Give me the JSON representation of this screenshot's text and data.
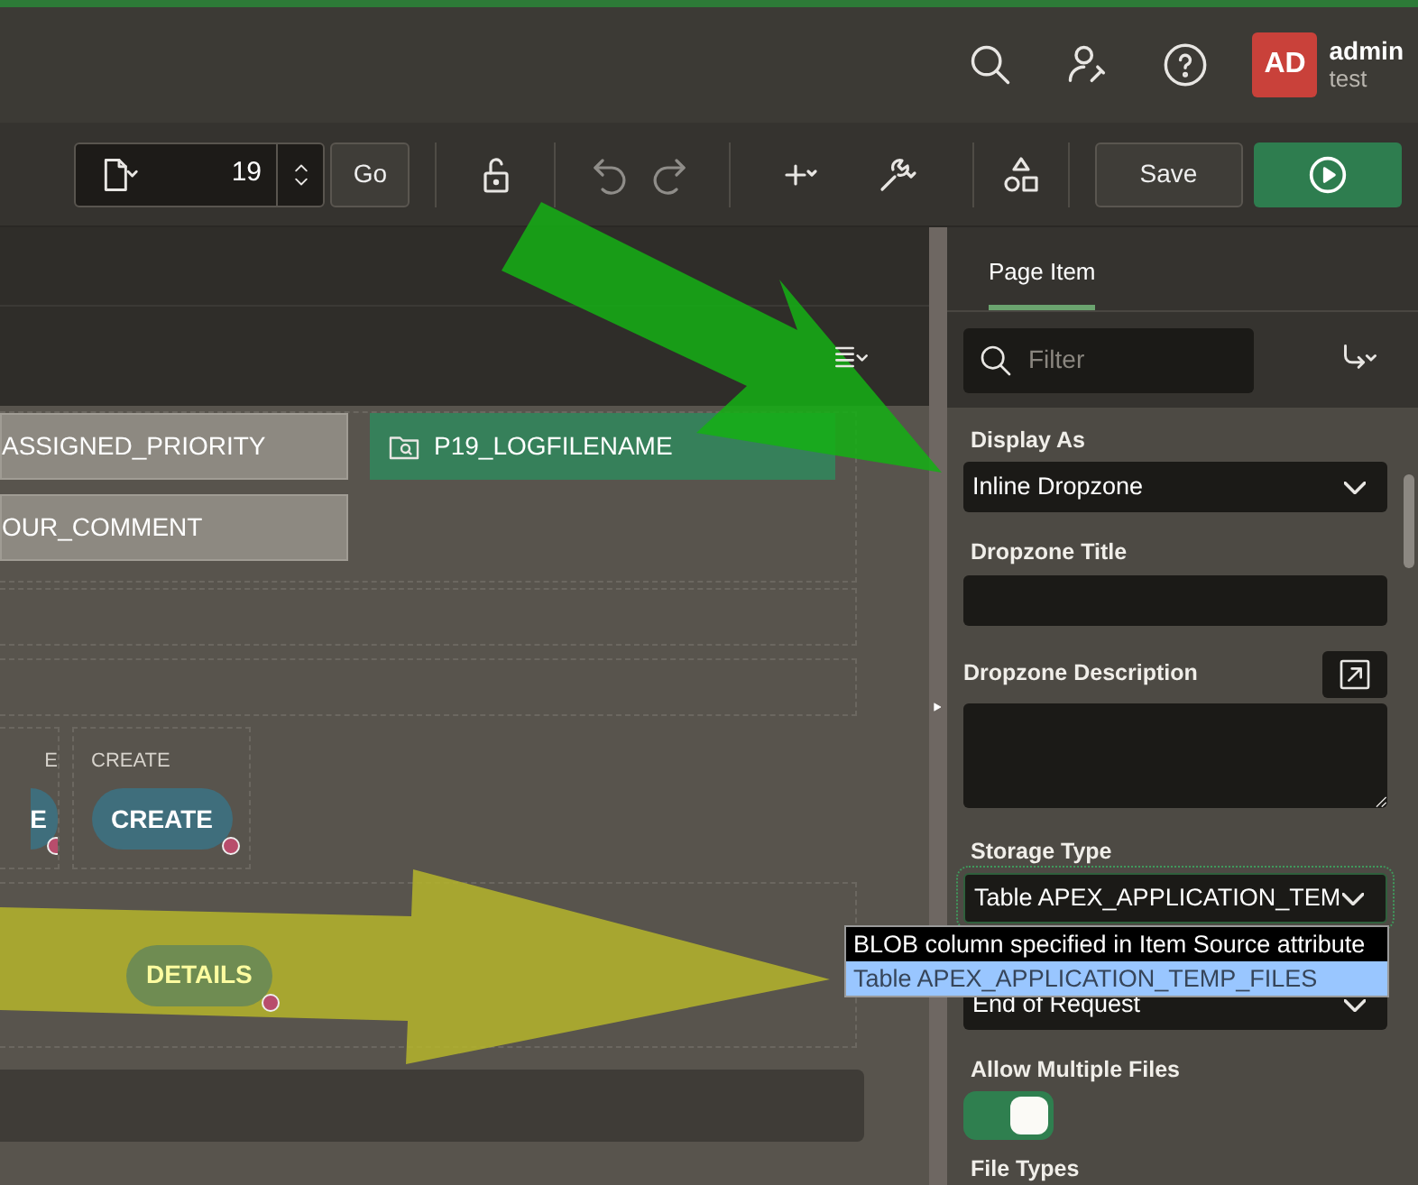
{
  "header": {
    "avatar": "AD",
    "user": "admin",
    "workspace": "test"
  },
  "toolbar": {
    "page_number": "19",
    "go": "Go",
    "save": "Save"
  },
  "canvas": {
    "items": [
      {
        "label": "ASSIGNED_PRIORITY",
        "selected": false
      },
      {
        "label": "P19_LOGFILENAME",
        "selected": true
      },
      {
        "label": "OUR_COMMENT",
        "selected": false
      }
    ],
    "button_regions": [
      {
        "label": "E",
        "button": "E"
      },
      {
        "label": "CREATE",
        "button": "CREATE"
      }
    ],
    "details_button": "DETAILS"
  },
  "property_editor": {
    "tab": {
      "label": "Page Item",
      "selected": true
    },
    "filter": {
      "placeholder": "Filter"
    },
    "properties": [
      {
        "kind": "select",
        "label": "Display As",
        "value": "Inline Dropzone",
        "focused": false
      },
      {
        "kind": "text",
        "label": "Dropzone Title"
      },
      {
        "kind": "textarea",
        "label": "Dropzone Description"
      },
      {
        "kind": "select",
        "label": "Storage Type",
        "value": "Table APEX_APPLICATION_TEM",
        "focused": true
      },
      {
        "kind": "select",
        "value": "End of Request",
        "focused": false
      },
      {
        "kind": "switch",
        "label": "Allow Multiple Files",
        "on": true
      },
      {
        "kind": "heading",
        "label": "File Types"
      }
    ],
    "dropdown": [
      {
        "label": "BLOB column specified in Item Source attribute",
        "selected": false
      },
      {
        "label": "Table APEX_APPLICATION_TEMP_FILES",
        "selected": true
      }
    ]
  }
}
